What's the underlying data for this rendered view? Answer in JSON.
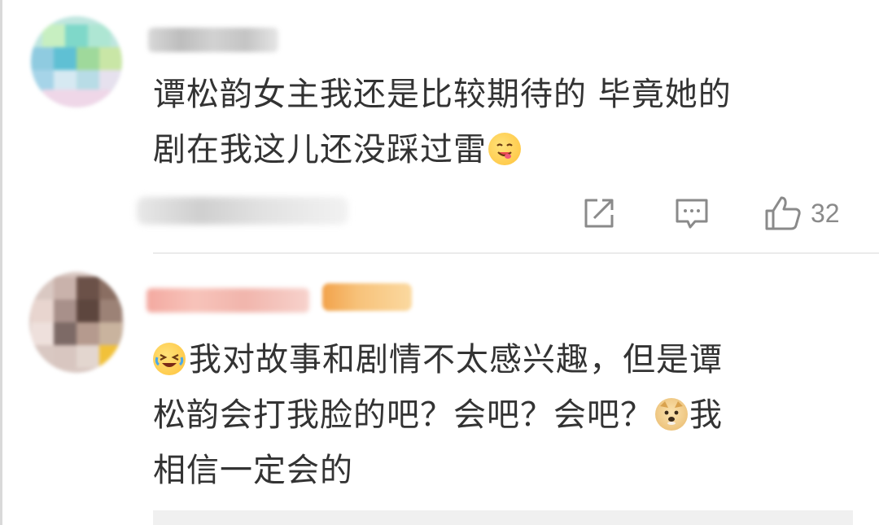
{
  "comments": [
    {
      "content_lines": [
        "谭松韵女主我还是比较期待的 毕竟她的",
        "剧在我这儿还没踩过雷"
      ],
      "emoji": "yum-face-emoji",
      "actions": {
        "share_icon": "share-icon",
        "reply_icon": "comment-icon",
        "like_icon": "thumbs-up-icon",
        "like_count": "32"
      }
    },
    {
      "content_lines": [
        "我对故事和剧情不太感兴趣，但是谭",
        "松韵会打我脸的吧？会吧？会吧？",
        "我",
        "相信一定会的"
      ],
      "emojis": [
        "laugh-cry-emoji",
        "doge-emoji"
      ]
    }
  ],
  "colors": {
    "text": "#333333",
    "muted": "#8a8a8a",
    "divider": "#ebebeb",
    "badge": "#f7c27a"
  }
}
